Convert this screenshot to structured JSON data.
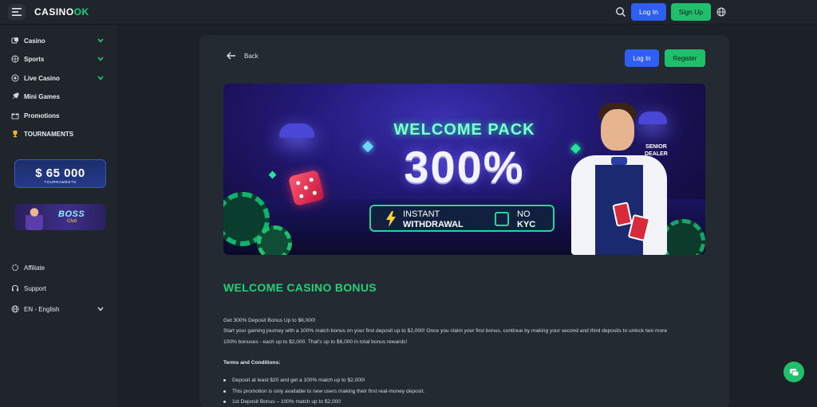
{
  "header": {
    "logo_text": "CASINO",
    "logo_accent": "K",
    "login_label": "Log In",
    "signup_label": "Sign Up"
  },
  "sidebar": {
    "items": [
      {
        "label": "Casino",
        "icon": "dice-icon",
        "has_chevron": true
      },
      {
        "label": "Sports",
        "icon": "ball-icon",
        "has_chevron": true
      },
      {
        "label": "Live Casino",
        "icon": "live-icon",
        "has_chevron": true
      },
      {
        "label": "Mini Games",
        "icon": "rocket-icon",
        "has_chevron": false
      },
      {
        "label": "Promotions",
        "icon": "gift-icon",
        "has_chevron": false
      },
      {
        "label": "TOURNAMENTS",
        "icon": "trophy-icon",
        "has_chevron": false
      }
    ],
    "promo_tournaments": {
      "amount": "$ 65 000",
      "caption": "TOURNAMENTS"
    },
    "promo_boss": {
      "title": "BOSS",
      "subtitle": "Club"
    },
    "bottom": [
      {
        "label": "Affiliate",
        "icon": "affiliate-icon"
      },
      {
        "label": "Support",
        "icon": "headset-icon"
      },
      {
        "label": "EN - English",
        "icon": "globe-icon"
      }
    ]
  },
  "main": {
    "back_label": "Back",
    "login_label": "Log In",
    "register_label": "Register",
    "hero": {
      "heading": "WELCOME PACK",
      "percent": "300%",
      "feature1_line1": "INSTANT",
      "feature1_line2": "WITHDRAWAL",
      "feature2_line1": "NO",
      "feature2_line2": "KYC",
      "badge_line1": "SENIOR",
      "badge_line2": "DEALER"
    },
    "bonus_title": "WELCOME CASINO BONUS",
    "paragraphs": [
      "Get 300% Deposit Bonus  Up to $6,000!",
      "Start your gaming journey with a 100% match bonus on your first deposit  up to $2,000! Once you claim your first bonus, continue by making your second and third deposits to unlock two more",
      "100% bonuses - each up to $2,000. That's up to $6,000 in total bonus rewards!"
    ],
    "terms_heading": "Terms and Conditions:",
    "terms": [
      "Deposit at least $20 and get a 100% match up to $2,000!",
      "This promotion is only available to new users making their first real-money deposit.",
      "1st Deposit Bonus – 100% match up to $2,000"
    ]
  },
  "colors": {
    "accent_green": "#1fbf6b",
    "accent_blue": "#2f5ef2",
    "bg": "#1b2127",
    "panel": "#232a31"
  }
}
